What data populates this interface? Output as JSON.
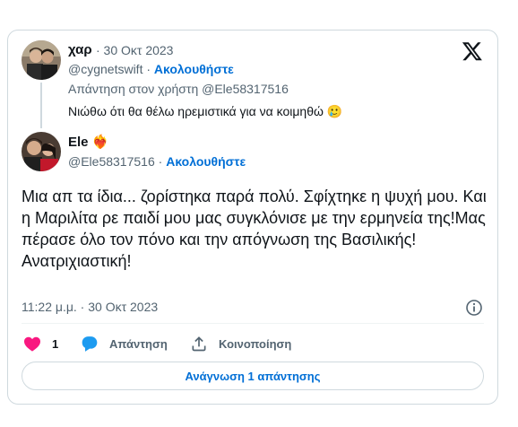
{
  "quoted": {
    "display_name": "χαρ",
    "date": "· 30 Οκτ 2023",
    "handle": "@cygnetswift",
    "follow_label": "Ακολουθήστε",
    "reply_prefix": "Απάντηση στον χρήστη",
    "reply_handle": "@Ele58317516",
    "text": "Νιώθω ότι θα θέλω ηρεμιστικά για να κοιμηθώ 🥲"
  },
  "tweet": {
    "display_name": "Ele ❤️‍🔥",
    "handle": "@Ele58317516",
    "follow_label": "Ακολουθήστε",
    "text": "Μια απ τα ίδια... ζορίστηκα παρά πολύ. Σφίχτηκε η ψυχή μου. Και η Μαριλίτα ρε παιδί μου μας συγκλόνισε με την ερμηνεία της!Μας πέρασε όλο τον πόνο και την απόγνωση της Βασιλικής!\nΑνατριχιαστική!",
    "timestamp": "11:22 μ.μ. · 30 Οκτ 2023"
  },
  "actions": {
    "likes": "1",
    "reply_label": "Απάντηση",
    "share_label": "Κοινοποίηση"
  },
  "read_replies_label": "Ανάγνωση 1 απάντησης",
  "colors": {
    "like": "#f91880",
    "reply": "#1d9bf0",
    "link": "#006fd6",
    "border": "#cfd9de"
  }
}
